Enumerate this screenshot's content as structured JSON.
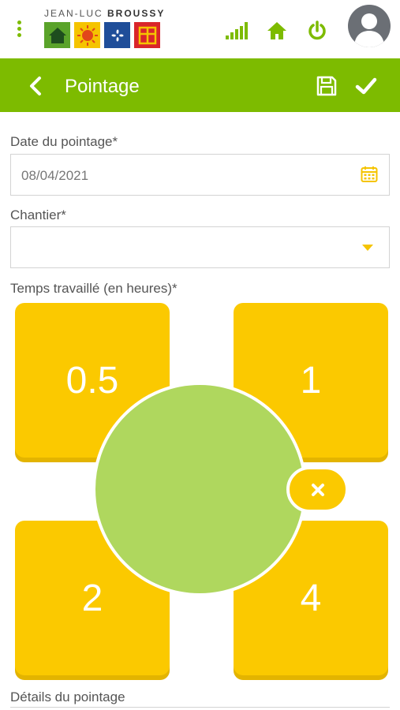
{
  "brand": {
    "name_light": "JEAN-LUC ",
    "name_bold": "BROUSSY"
  },
  "header": {
    "title": "Pointage"
  },
  "form": {
    "date_label": "Date du pointage*",
    "date_value": "08/04/2021",
    "chantier_label": "Chantier*",
    "chantier_value": "",
    "temps_label": "Temps travaillé (en heures)*",
    "details_label": "Détails du pointage"
  },
  "time_options": [
    "0.5",
    "1",
    "2",
    "4"
  ],
  "icons": {
    "menu": "kebab-menu-icon",
    "signal": "signal-icon",
    "home": "home-icon",
    "power": "power-icon",
    "avatar": "user-avatar-icon",
    "back": "chevron-left-icon",
    "save": "floppy-disk-icon",
    "confirm": "check-icon",
    "calendar": "calendar-icon",
    "dropdown": "caret-down-icon",
    "clear": "close-icon"
  },
  "colors": {
    "brand_green": "#7dbb00",
    "tile_yellow": "#fbc900",
    "dial_green": "#afd75e",
    "avatar_gray": "#6b6f75"
  }
}
